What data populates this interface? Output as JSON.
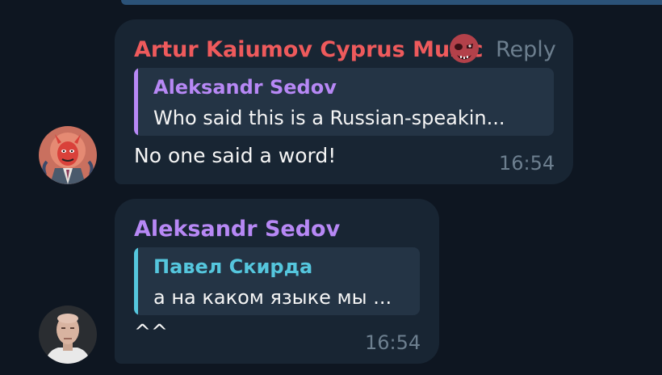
{
  "colors": {
    "background": "#0e1621",
    "bubble": "#182533",
    "quote_bg": "#243445",
    "name_red": "#ee5a5c",
    "name_purple": "#b788f5",
    "name_cyan": "#55c6dd",
    "meta_gray": "#6d7f8f"
  },
  "messages": [
    {
      "sender": "Artur Kaiumov Cyprus Music",
      "sender_emoji": "skull-emoji",
      "reply_label": "Reply",
      "quote": {
        "author": "Aleksandr Sedov",
        "text": "Who said this is a Russian-speakin..."
      },
      "text": "No one said a word!",
      "time": "16:54",
      "avatar": "devil-cartoon-avatar"
    },
    {
      "sender": "Aleksandr Sedov",
      "quote": {
        "author": "Павел Скирда",
        "text": "а на каком языке мы ..."
      },
      "text": "^^",
      "time": "16:54",
      "avatar": "bald-man-avatar"
    }
  ]
}
